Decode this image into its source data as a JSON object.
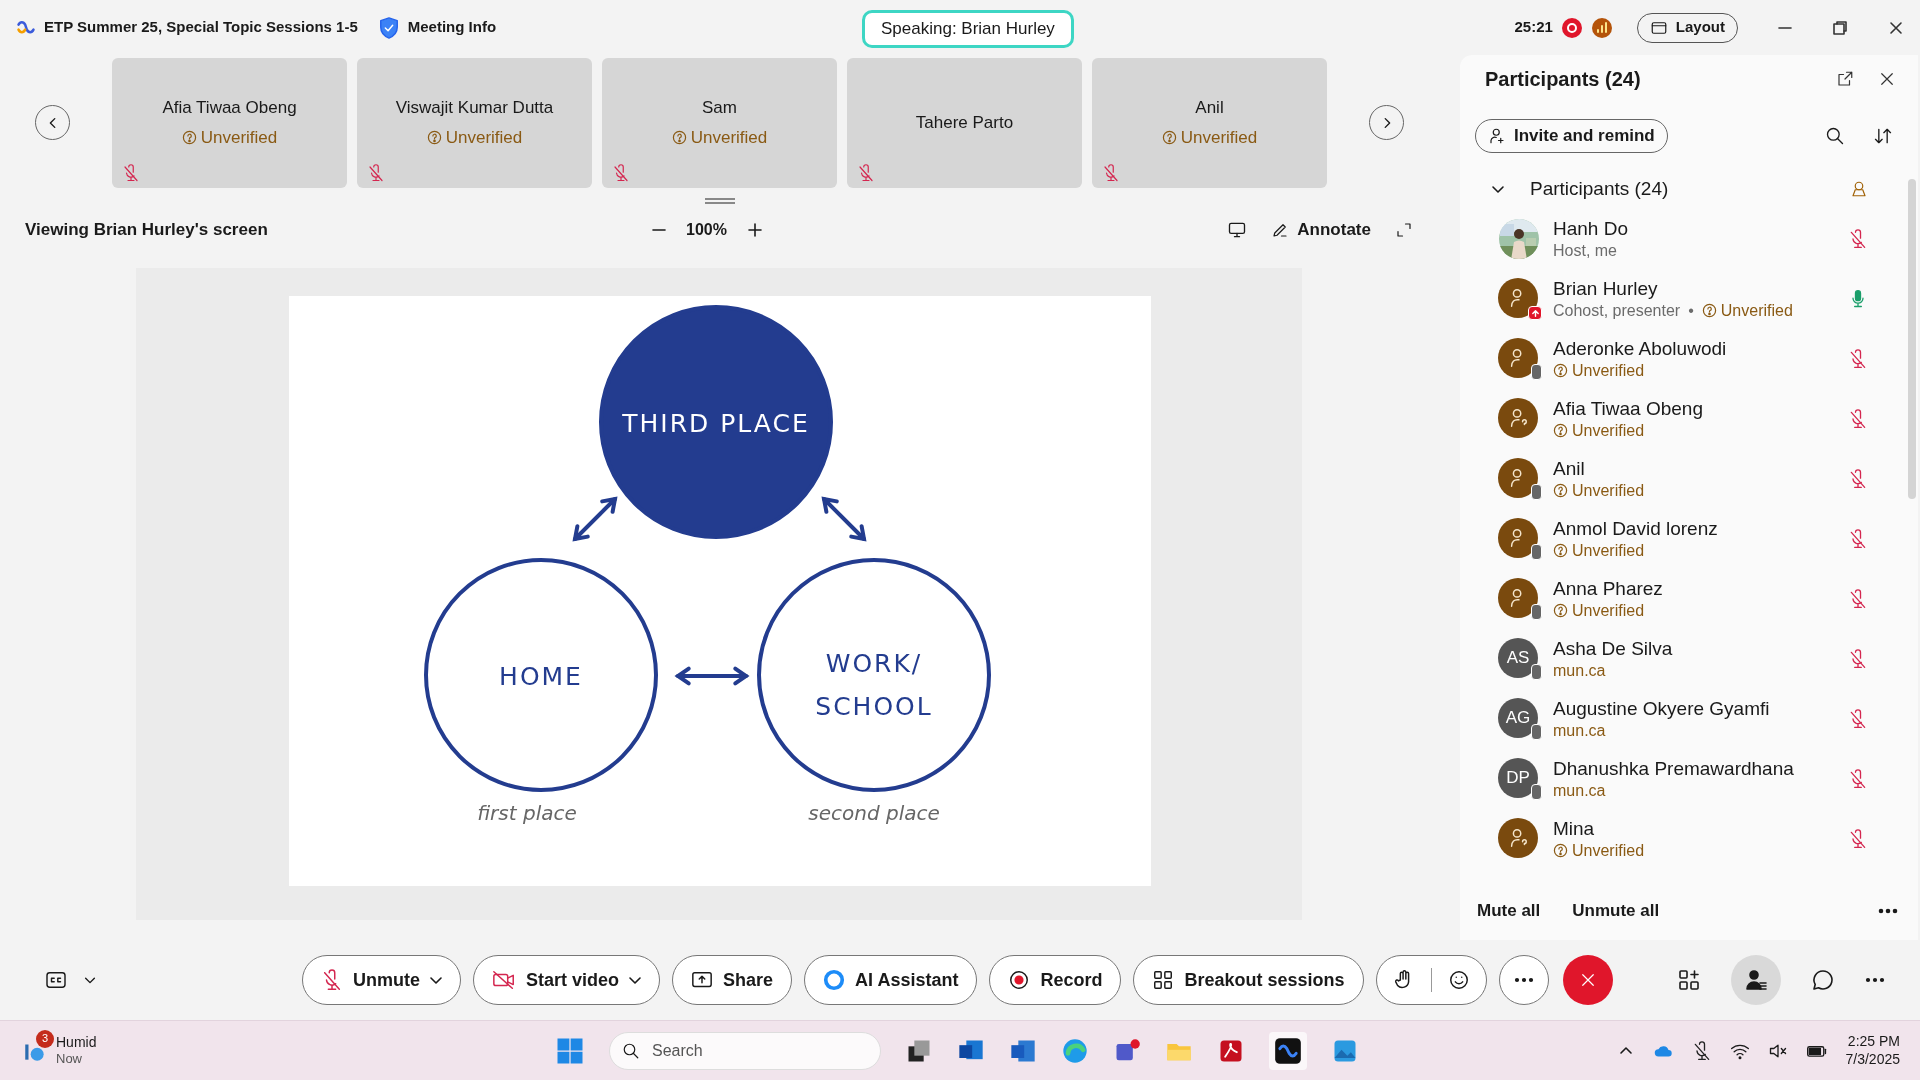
{
  "window": {
    "title": "ETP Summer 25, Special Topic Sessions 1-5",
    "meeting_info": "Meeting Info",
    "speaking": "Speaking: Brian Hurley",
    "timer": "25:21",
    "layout_button": "Layout"
  },
  "tiles": [
    {
      "name": "Afia Tiwaa Obeng",
      "unverified": "Unverified",
      "muted": true
    },
    {
      "name": "Viswajit Kumar Dutta",
      "unverified": "Unverified",
      "muted": true
    },
    {
      "name": "Sam",
      "unverified": "Unverified",
      "muted": true
    },
    {
      "name": "Tahere Parto",
      "muted": true
    },
    {
      "name": "Anil",
      "unverified": "Unverified",
      "muted": true
    }
  ],
  "share_bar": {
    "viewing": "Viewing Brian Hurley's screen",
    "zoom": "100%",
    "annotate": "Annotate"
  },
  "slide": {
    "circles": [
      {
        "kind": "filled",
        "label": "THIRD PLACE"
      },
      {
        "kind": "outline",
        "label": "HOME",
        "caption": "first place"
      },
      {
        "kind": "outline",
        "label": "WORK/",
        "label_2": "SCHOOL",
        "caption": "second place"
      }
    ]
  },
  "participants_panel": {
    "title": "Participants (24)",
    "invite_button": "Invite and remind",
    "section": {
      "label": "Participants (24)",
      "expanded": true
    },
    "rows": [
      {
        "name": "Hanh Do",
        "role": "Host, me",
        "muted": true
      },
      {
        "name": "Brian Hurley",
        "kind": "person",
        "sharing": true,
        "role": "Cohost, presenter",
        "separator": "•",
        "unverified": "Unverified",
        "muted": false
      },
      {
        "name": "Aderonke Aboluwodi",
        "kind": "person",
        "phone": true,
        "unverified": "Unverified",
        "muted": true
      },
      {
        "name": "Afia Tiwaa Obeng",
        "kind": "guest",
        "unverified": "Unverified",
        "muted": true
      },
      {
        "name": "Anil",
        "kind": "person",
        "phone": true,
        "unverified": "Unverified",
        "muted": true
      },
      {
        "name": "Anmol David lorenz",
        "kind": "person",
        "phone": true,
        "unverified": "Unverified",
        "muted": true
      },
      {
        "name": "Anna Pharez",
        "kind": "person",
        "phone": true,
        "unverified": "Unverified",
        "muted": true
      },
      {
        "name": "Asha De Silva",
        "kind": "initials",
        "initials": "AS",
        "phone": true,
        "domain": "mun.ca",
        "muted": true
      },
      {
        "name": "Augustine Okyere Gyamfi",
        "kind": "initials",
        "initials": "AG",
        "phone": true,
        "domain": "mun.ca",
        "muted": true
      },
      {
        "name": "Dhanushka Premawardhana",
        "kind": "initials",
        "initials": "DP",
        "phone": true,
        "domain": "mun.ca",
        "muted": true
      },
      {
        "name": "Mina",
        "kind": "guest",
        "unverified": "Unverified",
        "muted": true
      }
    ],
    "mute_all": "Mute all",
    "unmute_all": "Unmute all"
  },
  "toolbar": {
    "buttons": [
      {
        "kind": "unmute",
        "label": "Unmute",
        "menu": true
      },
      {
        "kind": "video",
        "label": "Start video",
        "menu": true
      },
      {
        "kind": "share",
        "label": "Share"
      },
      {
        "kind": "ai",
        "label": "AI Assistant"
      },
      {
        "kind": "record",
        "label": "Record"
      },
      {
        "kind": "breakout",
        "label": "Breakout sessions"
      }
    ],
    "participants_selected": true
  },
  "taskbar": {
    "weather": {
      "badge": "3",
      "label": "Humid",
      "sub": "Now"
    },
    "search": "Search",
    "time": "2:25 PM",
    "date": "7/3/2025"
  }
}
